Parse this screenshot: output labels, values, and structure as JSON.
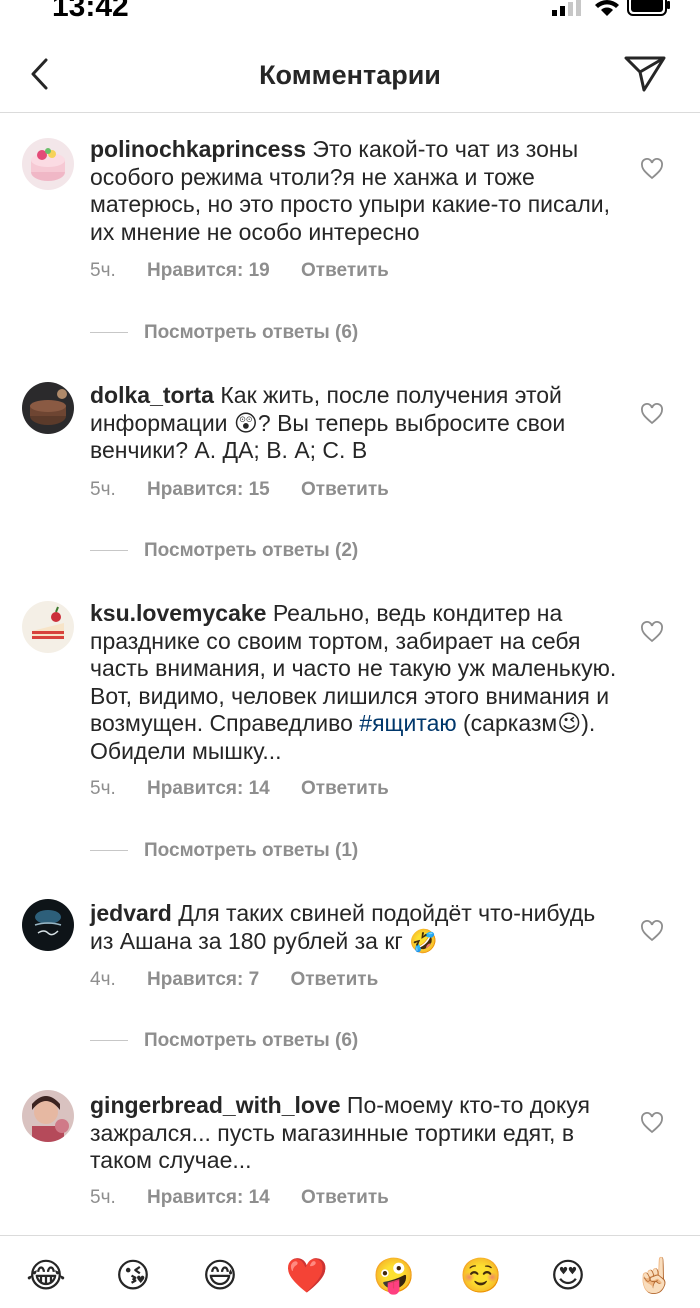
{
  "status_bar": {
    "time": "13:42"
  },
  "header": {
    "title": "Комментарии",
    "back_icon": "chevron-left-icon",
    "send_icon": "paper-plane-icon"
  },
  "comments": [
    {
      "username": "polinochkaprincess",
      "text": "Это какой-то чат из зоны особого режима чтоли?я не ханжа и тоже матерюсь, но это просто упыри какие-то писали, их мнение не особо интересно",
      "time": "5ч.",
      "likes": "Нравится: 19",
      "reply": "Ответить",
      "view_replies": "Посмотреть ответы (6)"
    },
    {
      "username": "dolka_torta",
      "text": "Как жить, после получения этой информации 😲? Вы теперь выбросите свои венчики? А. ДА; В. А; С. В",
      "time": "5ч.",
      "likes": "Нравится: 15",
      "reply": "Ответить",
      "view_replies": "Посмотреть ответы (2)"
    },
    {
      "username": "ksu.lovemycake",
      "text_before": "Реально, ведь кондитер на празднике со своим тортом, забирает на себя часть внимания, и часто не такую уж маленькую. Вот, видимо, человек лишился этого внимания и возмущен. Справедливо ",
      "hashtag": "#ящитаю",
      "text_after": " (сарказм😉). Обидели мышку...",
      "time": "5ч.",
      "likes": "Нравится: 14",
      "reply": "Ответить",
      "view_replies": "Посмотреть ответы (1)"
    },
    {
      "username": "jedvard",
      "text": "Для таких свиней подойдёт  что-нибудь из Ашана за 180 рублей за кг 🤣",
      "time": "4ч.",
      "likes": "Нравится: 7",
      "reply": "Ответить",
      "view_replies": "Посмотреть ответы (6)"
    },
    {
      "username": "gingerbread_with_love",
      "text": "По-моему кто-то докуя зажрался... пусть магазинные тортики едят, в таком случае...",
      "time": "5ч.",
      "likes": "Нравится: 14",
      "reply": "Ответить"
    }
  ],
  "emoji_bar": [
    "😂",
    "😘",
    "😅",
    "❤️",
    "🤪",
    "☺️",
    "😍",
    "☝🏻"
  ]
}
